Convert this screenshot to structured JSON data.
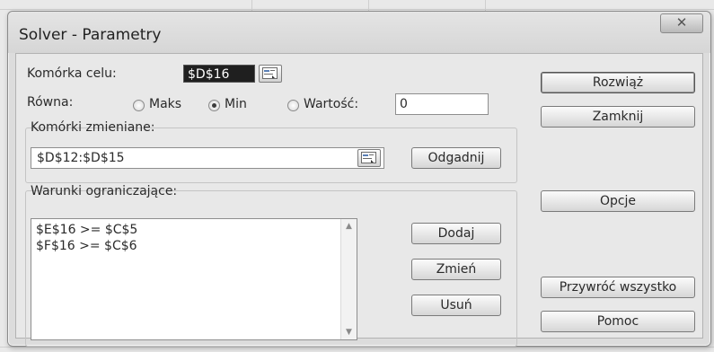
{
  "dialog": {
    "title": "Solver - Parametry",
    "close_glyph": "✕"
  },
  "target": {
    "label": "Komórka celu:",
    "value": "$D$16"
  },
  "equal": {
    "label": "Równa:",
    "options": [
      {
        "label": "Maks",
        "selected": false
      },
      {
        "label": "Min",
        "selected": true
      },
      {
        "label": "Wartość:",
        "selected": false
      }
    ],
    "value": "0"
  },
  "changing": {
    "label": "Komórki zmieniane:",
    "value": "$D$12:$D$15",
    "guess_label": "Odgadnij"
  },
  "constraints": {
    "label": "Warunki ograniczające:",
    "items": [
      "$E$16 >= $C$5",
      "$F$16 >= $C$6"
    ],
    "add_label": "Dodaj",
    "change_label": "Zmień",
    "delete_label": "Usuń"
  },
  "actions": {
    "solve": "Rozwiąż",
    "close": "Zamknij",
    "options": "Opcje",
    "reset": "Przywróć wszystko",
    "help": "Pomoc"
  }
}
